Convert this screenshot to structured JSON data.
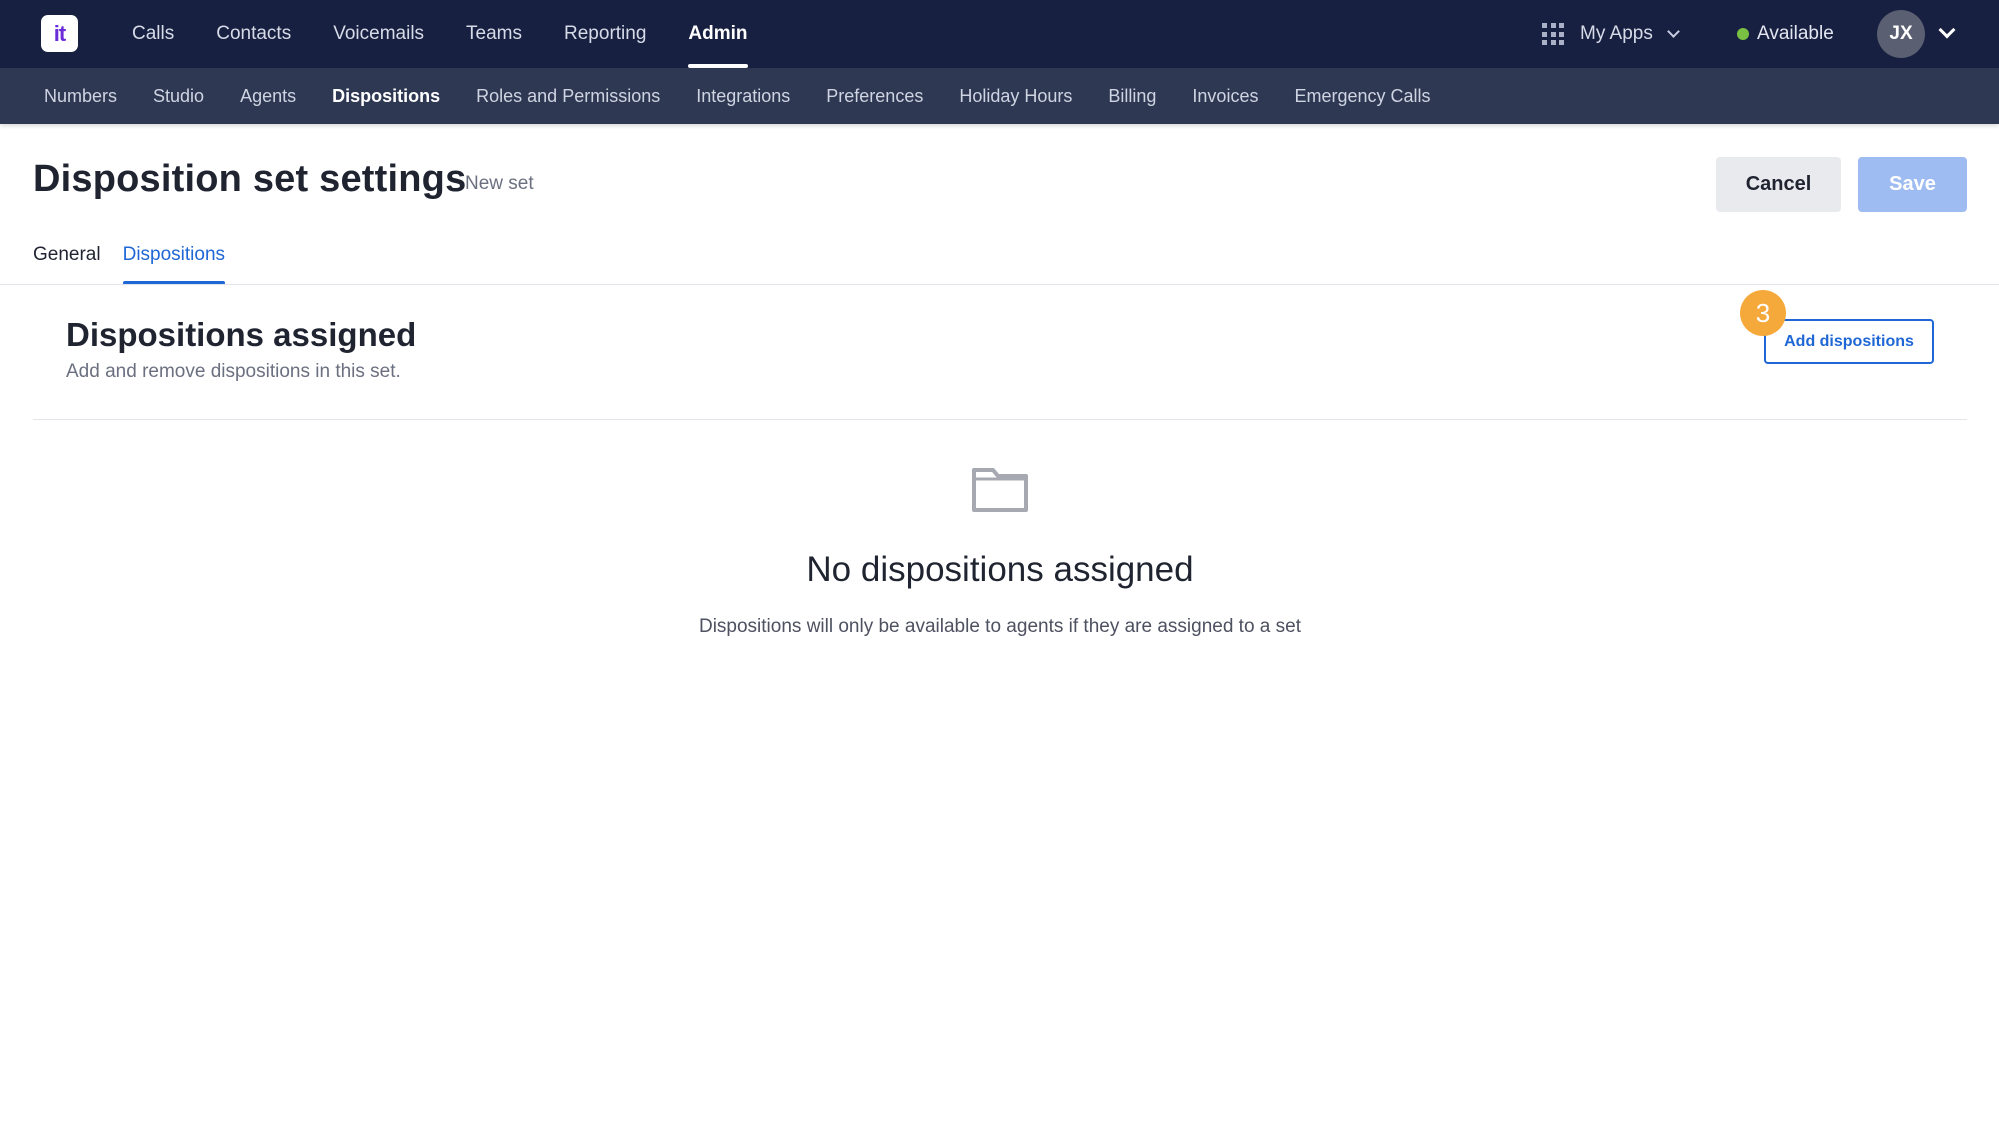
{
  "topnav": {
    "logo_text": "it",
    "items": [
      {
        "label": "Calls"
      },
      {
        "label": "Contacts"
      },
      {
        "label": "Voicemails"
      },
      {
        "label": "Teams"
      },
      {
        "label": "Reporting"
      },
      {
        "label": "Admin",
        "active": true
      }
    ],
    "my_apps_label": "My Apps",
    "status_label": "Available",
    "status_color": "#79c142",
    "avatar_initials": "JX"
  },
  "subnav": {
    "items": [
      {
        "label": "Numbers"
      },
      {
        "label": "Studio"
      },
      {
        "label": "Agents"
      },
      {
        "label": "Dispositions",
        "active": true
      },
      {
        "label": "Roles and Permissions"
      },
      {
        "label": "Integrations"
      },
      {
        "label": "Preferences"
      },
      {
        "label": "Holiday Hours"
      },
      {
        "label": "Billing"
      },
      {
        "label": "Invoices"
      },
      {
        "label": "Emergency Calls"
      }
    ]
  },
  "header": {
    "title": "Disposition set settings",
    "subtitle": "New set",
    "cancel_label": "Cancel",
    "save_label": "Save"
  },
  "tabs": [
    {
      "label": "General"
    },
    {
      "label": "Dispositions",
      "active": true
    }
  ],
  "section": {
    "title": "Dispositions assigned",
    "description": "Add and remove dispositions in this set.",
    "add_button_label": "Add dispositions",
    "step_badge": "3"
  },
  "empty_state": {
    "icon": "folder-icon",
    "title": "No dispositions assigned",
    "description": "Dispositions will only be available to agents if they are assigned to a set"
  },
  "colors": {
    "topbar": "#172040",
    "subbar": "#2e3853",
    "accent": "#1f67d6",
    "save_disabled": "#9ebcf2",
    "badge": "#f6a93b"
  }
}
